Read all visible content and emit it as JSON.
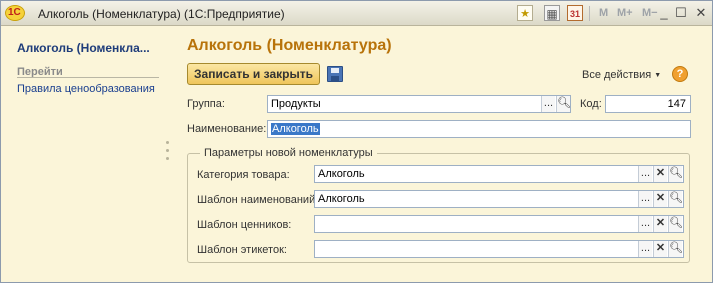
{
  "window": {
    "title": "Алкоголь (Номенклатура)  (1С:Предприятие)",
    "logo_text": "1С",
    "toolbar_m": "M",
    "toolbar_mplus": "M+",
    "toolbar_mminus": "M−",
    "icons": [
      "star-icon",
      "calculator-icon",
      "calendar-icon",
      "minimize-icon",
      "maximize-icon",
      "close-icon"
    ]
  },
  "sidebar": {
    "title": "Алкоголь (Номенкла...",
    "section": "Перейти",
    "items": [
      {
        "label": "Правила ценообразования"
      }
    ]
  },
  "main": {
    "title": "Алкоголь (Номенклатура)",
    "save_close_label": "Записать и закрыть",
    "actions_label": "Все действия",
    "help_label": "?",
    "group": {
      "label": "Группа:",
      "value": "Продукты"
    },
    "code": {
      "label": "Код:",
      "value": "147"
    },
    "name": {
      "label": "Наименование:",
      "value": "Алкоголь"
    },
    "params_group": {
      "title": "Параметры новой номенклатуры",
      "fields": [
        {
          "label": "Категория товара:",
          "value": "Алкоголь"
        },
        {
          "label": "Шаблон наименований:",
          "value": "Алкоголь"
        },
        {
          "label": "Шаблон ценников:",
          "value": ""
        },
        {
          "label": "Шаблон этикеток:",
          "value": ""
        }
      ]
    },
    "field_buttons": {
      "select": "...",
      "clear": "✕",
      "open": "⚲"
    }
  },
  "colors": {
    "accent_title": "#b8730a",
    "link": "#1a3f8f",
    "background": "#fbf5d9",
    "selection": "#3a78c8"
  }
}
